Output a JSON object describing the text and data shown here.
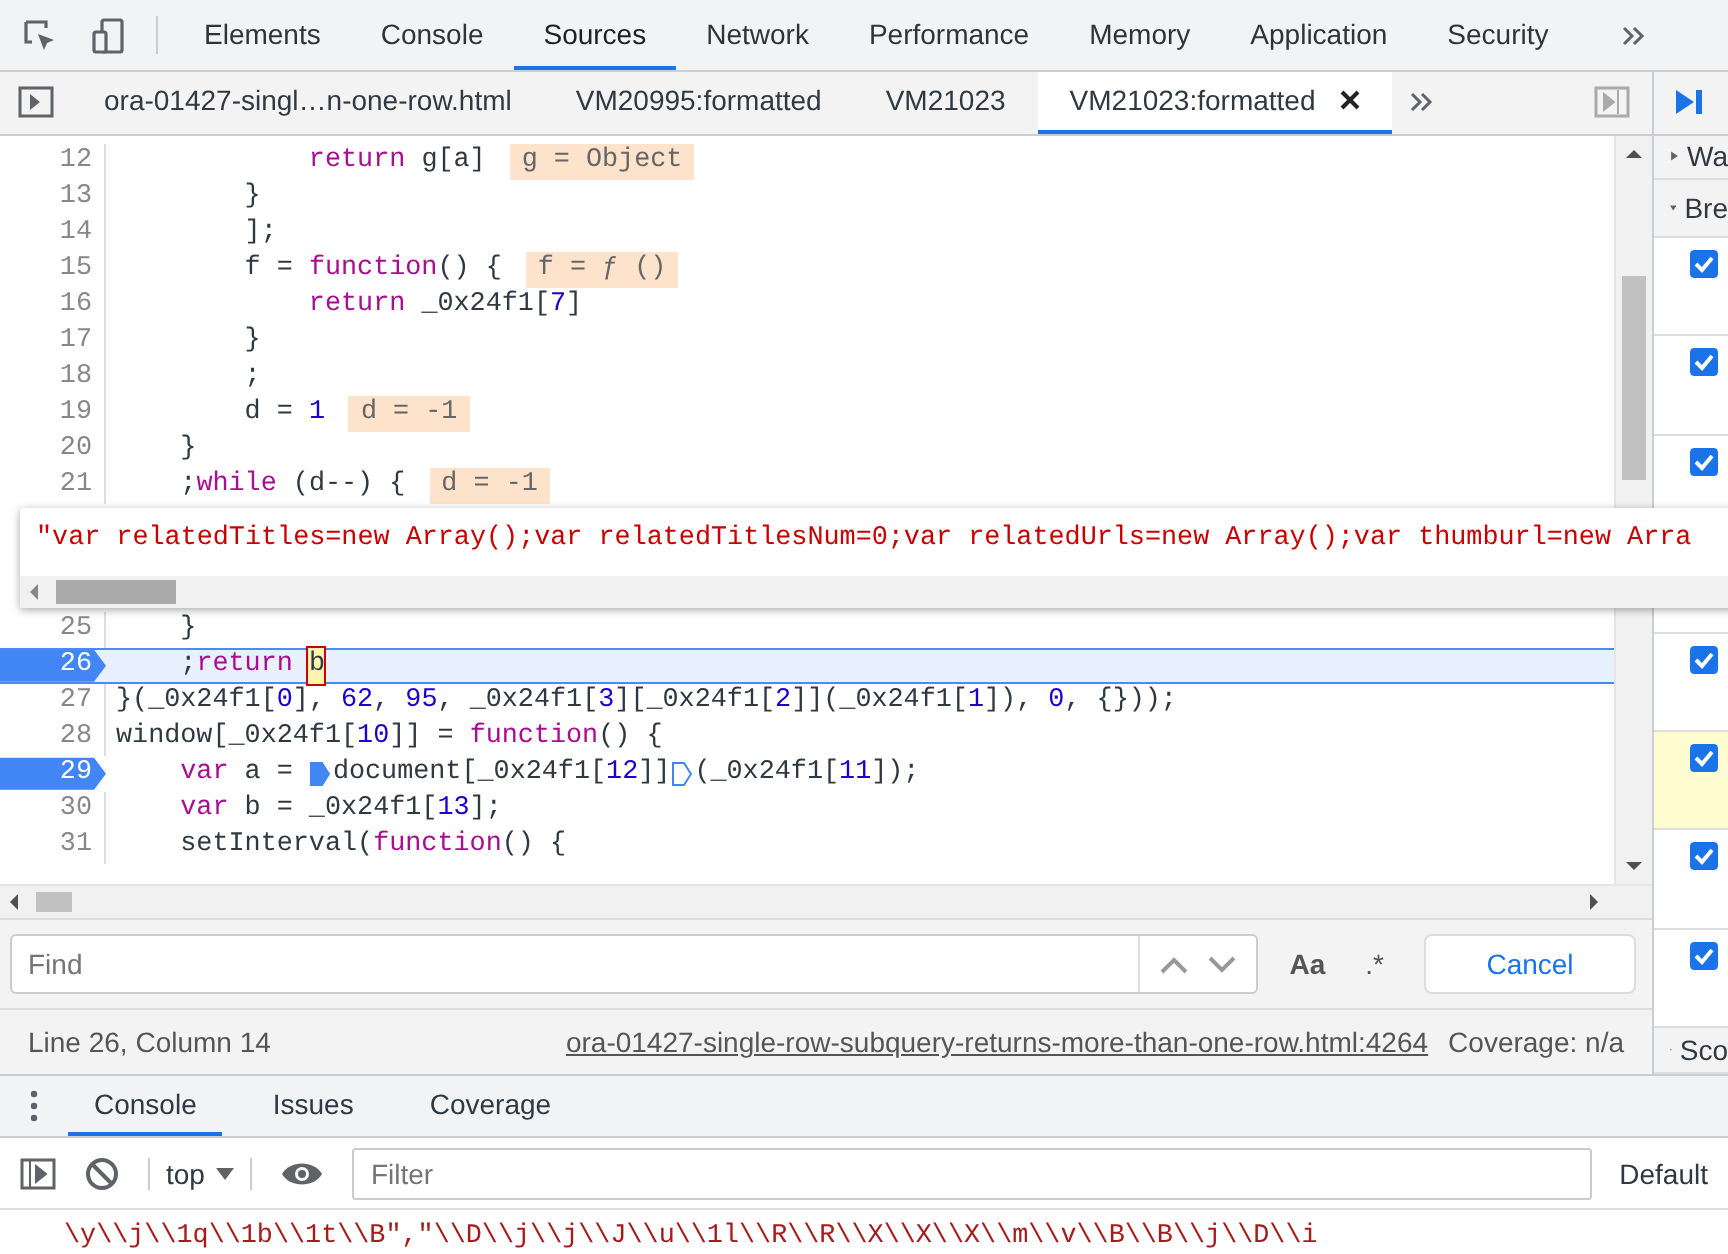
{
  "main_tabs": [
    {
      "label": "Elements",
      "selected": false
    },
    {
      "label": "Console",
      "selected": false
    },
    {
      "label": "Sources",
      "selected": true
    },
    {
      "label": "Network",
      "selected": false
    },
    {
      "label": "Performance",
      "selected": false
    },
    {
      "label": "Memory",
      "selected": false
    },
    {
      "label": "Application",
      "selected": false
    },
    {
      "label": "Security",
      "selected": false
    }
  ],
  "file_tabs": [
    {
      "label": "ora-01427-singl…n-one-row.html",
      "selected": false
    },
    {
      "label": "VM20995:formatted",
      "selected": false
    },
    {
      "label": "VM21023",
      "selected": false
    },
    {
      "label": "VM21023:formatted",
      "selected": true
    }
  ],
  "code_lines": [
    {
      "number": "12",
      "breakpoint": false,
      "current": false,
      "segments": [
        {
          "kind": "keyword",
          "text": "            return"
        },
        {
          "kind": "plain",
          "text": " g[a]"
        },
        {
          "kind": "value",
          "text": "g = Object"
        }
      ]
    },
    {
      "number": "13",
      "breakpoint": false,
      "current": false,
      "segments": [
        {
          "kind": "plain",
          "text": "        }"
        }
      ]
    },
    {
      "number": "14",
      "breakpoint": false,
      "current": false,
      "segments": [
        {
          "kind": "plain",
          "text": "        ];"
        }
      ]
    },
    {
      "number": "15",
      "breakpoint": false,
      "current": false,
      "segments": [
        {
          "kind": "plain",
          "text": "        f = "
        },
        {
          "kind": "keyword",
          "text": "function"
        },
        {
          "kind": "plain",
          "text": "() {"
        },
        {
          "kind": "value",
          "text": "f = ƒ ()"
        }
      ]
    },
    {
      "number": "16",
      "breakpoint": false,
      "current": false,
      "segments": [
        {
          "kind": "keyword",
          "text": "            return"
        },
        {
          "kind": "plain",
          "text": " _0x24f1["
        },
        {
          "kind": "number",
          "text": "7"
        },
        {
          "kind": "plain",
          "text": "]"
        }
      ]
    },
    {
      "number": "17",
      "breakpoint": false,
      "current": false,
      "segments": [
        {
          "kind": "plain",
          "text": "        }"
        }
      ]
    },
    {
      "number": "18",
      "breakpoint": false,
      "current": false,
      "segments": [
        {
          "kind": "plain",
          "text": "        ;"
        }
      ]
    },
    {
      "number": "19",
      "breakpoint": false,
      "current": false,
      "segments": [
        {
          "kind": "plain",
          "text": "        d = "
        },
        {
          "kind": "number",
          "text": "1"
        },
        {
          "kind": "value",
          "text": "d = -1"
        }
      ]
    },
    {
      "number": "20",
      "breakpoint": false,
      "current": false,
      "segments": [
        {
          "kind": "plain",
          "text": "    }"
        }
      ]
    },
    {
      "number": "21",
      "breakpoint": false,
      "current": false,
      "segments": [
        {
          "kind": "plain",
          "text": "    ;"
        },
        {
          "kind": "keyword",
          "text": "while"
        },
        {
          "kind": "plain",
          "text": " (d--) {"
        },
        {
          "kind": "value",
          "text": "d = -1"
        }
      ]
    },
    {
      "number": "25",
      "breakpoint": false,
      "current": false,
      "segments": [
        {
          "kind": "plain",
          "text": "    }"
        }
      ]
    },
    {
      "number": "26",
      "breakpoint": true,
      "current": true,
      "segments": [
        {
          "kind": "plain",
          "text": "    ;"
        },
        {
          "kind": "keyword",
          "text": "return "
        },
        {
          "kind": "cursor",
          "text": "b"
        }
      ]
    },
    {
      "number": "27",
      "breakpoint": false,
      "current": false,
      "segments": [
        {
          "kind": "plain",
          "text": "}(_0x24f1["
        },
        {
          "kind": "number",
          "text": "0"
        },
        {
          "kind": "plain",
          "text": "], "
        },
        {
          "kind": "number",
          "text": "62"
        },
        {
          "kind": "plain",
          "text": ", "
        },
        {
          "kind": "number",
          "text": "95"
        },
        {
          "kind": "plain",
          "text": ", _0x24f1["
        },
        {
          "kind": "number",
          "text": "3"
        },
        {
          "kind": "plain",
          "text": "][_0x24f1["
        },
        {
          "kind": "number",
          "text": "2"
        },
        {
          "kind": "plain",
          "text": "]](_0x24f1["
        },
        {
          "kind": "number",
          "text": "1"
        },
        {
          "kind": "plain",
          "text": "]), "
        },
        {
          "kind": "number",
          "text": "0"
        },
        {
          "kind": "plain",
          "text": ", {}));"
        }
      ]
    },
    {
      "number": "28",
      "breakpoint": false,
      "current": false,
      "segments": [
        {
          "kind": "plain",
          "text": "window[_0x24f1["
        },
        {
          "kind": "number",
          "text": "10"
        },
        {
          "kind": "plain",
          "text": "]] = "
        },
        {
          "kind": "keyword",
          "text": "function"
        },
        {
          "kind": "plain",
          "text": "() {"
        }
      ]
    },
    {
      "number": "29",
      "breakpoint": true,
      "current": false,
      "segments": [
        {
          "kind": "keyword",
          "text": "    var"
        },
        {
          "kind": "plain",
          "text": " a = "
        },
        {
          "kind": "marker",
          "active": true
        },
        {
          "kind": "plain",
          "text": "document[_0x24f1["
        },
        {
          "kind": "number",
          "text": "12"
        },
        {
          "kind": "plain",
          "text": "]]"
        },
        {
          "kind": "marker",
          "active": false
        },
        {
          "kind": "plain",
          "text": "(_0x24f1["
        },
        {
          "kind": "number",
          "text": "11"
        },
        {
          "kind": "plain",
          "text": "]);"
        }
      ]
    },
    {
      "number": "30",
      "breakpoint": false,
      "current": false,
      "segments": [
        {
          "kind": "keyword",
          "text": "    var"
        },
        {
          "kind": "plain",
          "text": " b = _0x24f1["
        },
        {
          "kind": "number",
          "text": "13"
        },
        {
          "kind": "plain",
          "text": "];"
        }
      ]
    },
    {
      "number": "31",
      "breakpoint": false,
      "current": false,
      "segments": [
        {
          "kind": "plain",
          "text": "    setInterval("
        },
        {
          "kind": "keyword",
          "text": "function"
        },
        {
          "kind": "plain",
          "text": "() {"
        }
      ]
    }
  ],
  "popover": {
    "text": "\"var relatedTitles=new Array();var relatedTitlesNum=0;var relatedUrls=new Array();var thumburl=new Arra"
  },
  "sidebar": {
    "watch": {
      "label": "Wa",
      "expanded": false
    },
    "breakpoints_header": {
      "label": "Bre",
      "expanded": true
    },
    "breakpoints": [
      {
        "checked": true,
        "selected": false
      },
      {
        "checked": true,
        "selected": false
      },
      {
        "checked": true,
        "selected": false
      },
      {
        "checked": true,
        "selected": false
      },
      {
        "checked": true,
        "selected": true
      },
      {
        "checked": true,
        "selected": false
      },
      {
        "checked": true,
        "selected": false
      }
    ],
    "scope": {
      "label": "Sco",
      "expanded": true
    }
  },
  "find": {
    "placeholder": "Find",
    "match_case": "Aa",
    "regex": ".*",
    "cancel": "Cancel"
  },
  "status": {
    "position": "Line 26, Column 14",
    "source_link": "ora-01427-single-row-subquery-returns-more-than-one-row.html:4264",
    "coverage": "Coverage: n/a"
  },
  "drawer_tabs": [
    {
      "label": "Console",
      "selected": true
    },
    {
      "label": "Issues",
      "selected": false
    },
    {
      "label": "Coverage",
      "selected": false
    }
  ],
  "console_toolbar": {
    "context": "top",
    "filter_placeholder": "Filter",
    "levels": "Default"
  },
  "console_output": [
    "\\y\\\\j\\\\1q\\\\1b\\\\1t\\\\B\",\"\\\\D\\\\j\\\\j\\\\J\\\\u\\\\1l\\\\R\\\\R\\\\X\\\\X\\\\X\\\\m\\\\v\\\\B\\\\B\\\\j\\\\D\\\\i"
  ]
}
